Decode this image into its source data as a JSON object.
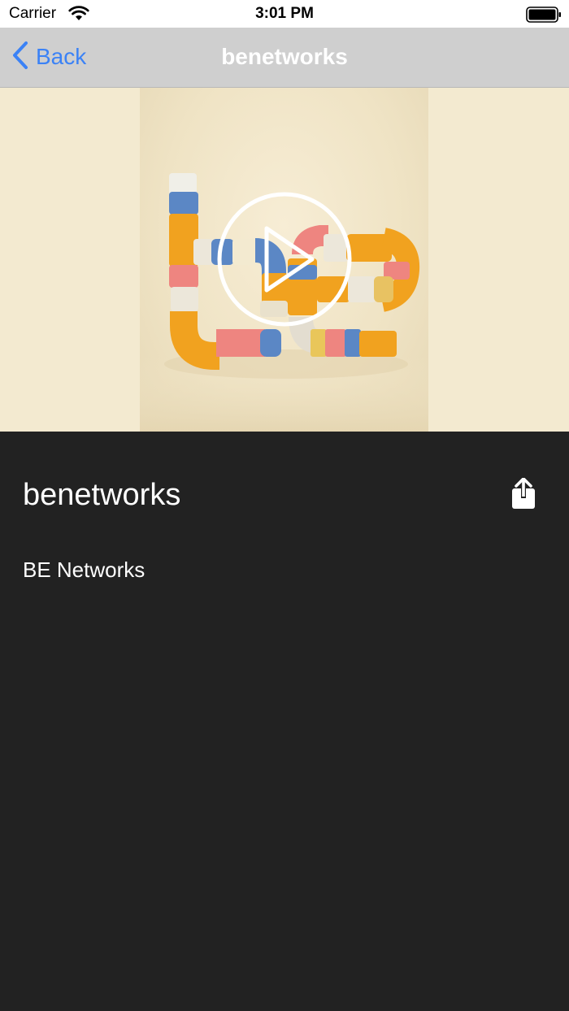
{
  "status_bar": {
    "carrier": "Carrier",
    "time": "3:01 PM",
    "icons": [
      "wifi-icon",
      "battery-icon"
    ]
  },
  "nav_bar": {
    "back_label": "Back",
    "title": "benetworks",
    "back_color": "#3b82f6",
    "background": "#cfcfcf"
  },
  "media": {
    "background": "#f3ead0",
    "icons": [
      "play-icon"
    ]
  },
  "content": {
    "title": "benetworks",
    "description": "BE Networks",
    "background": "#222222",
    "icons": [
      "share-icon"
    ]
  }
}
